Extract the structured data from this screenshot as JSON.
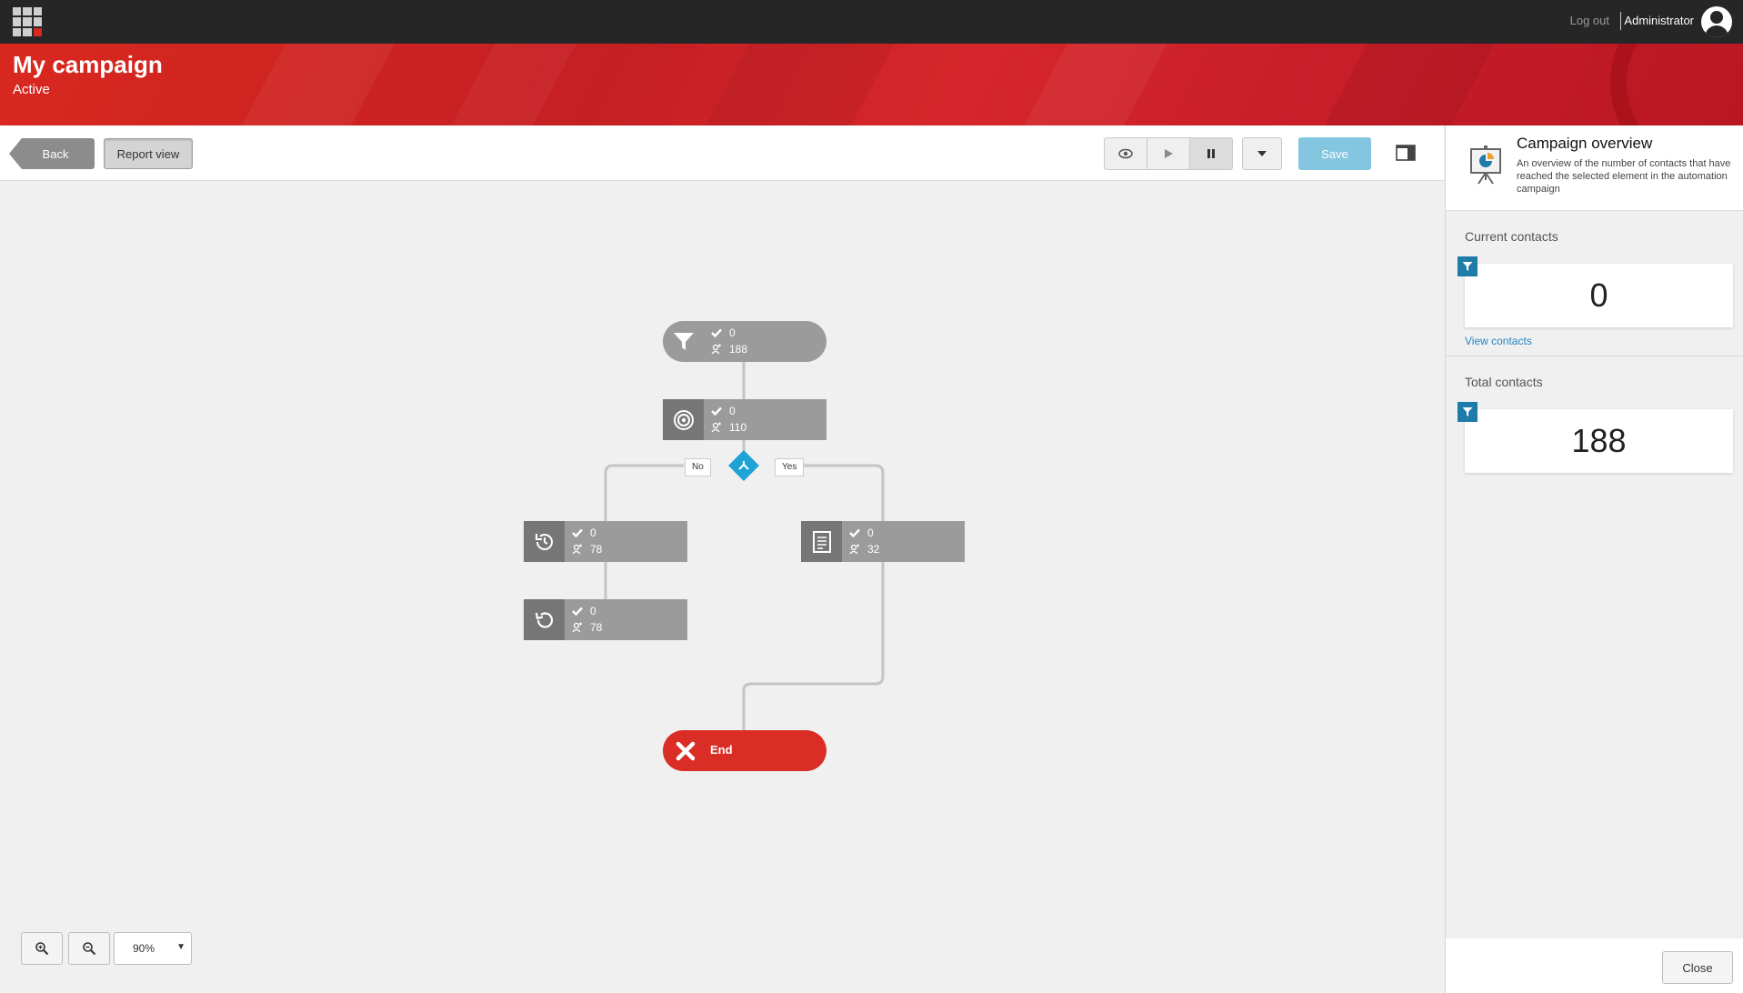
{
  "topbar": {
    "logout_label": "Log out",
    "user_name": "Administrator"
  },
  "header": {
    "title": "My campaign",
    "status": "Active"
  },
  "toolbar": {
    "back_label": "Back",
    "report_view_label": "Report view",
    "save_label": "Save"
  },
  "workflow": {
    "nodes": [
      {
        "icon": "funnel-icon",
        "completed": "0",
        "passed": "188"
      },
      {
        "icon": "target-icon",
        "completed": "0",
        "passed": "110"
      },
      {
        "icon": "wait-history-icon",
        "completed": "0",
        "passed": "78"
      },
      {
        "icon": "form-icon",
        "completed": "0",
        "passed": "32"
      },
      {
        "icon": "reset-icon",
        "completed": "0",
        "passed": "78"
      }
    ],
    "branch_no": "No",
    "branch_yes": "Yes",
    "end_label": "End"
  },
  "zoom": {
    "level": "90%"
  },
  "panel": {
    "title": "Campaign overview",
    "description": "An overview of the number of contacts that have reached the selected element in the automation campaign",
    "current_title": "Current contacts",
    "current_count": "0",
    "view_contacts_label": "View contacts",
    "total_title": "Total contacts",
    "total_count": "188",
    "close_label": "Close"
  },
  "colors": {
    "accent_red": "#d9281f",
    "end_red": "#da2d26",
    "save_blue": "#84c6e0",
    "condition_blue": "#1fa3d5",
    "filter_blue": "#1f7ba8"
  }
}
